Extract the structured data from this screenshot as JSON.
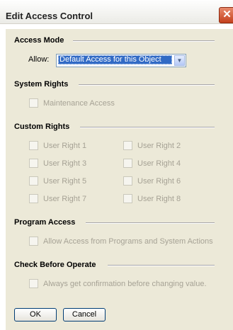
{
  "window": {
    "title": "Edit Access Control",
    "close_symbol": "✕"
  },
  "access_mode": {
    "heading": "Access Mode",
    "allow_label": "Allow:",
    "allow_value": "Default Access for this Object",
    "dropdown_arrow": "▼"
  },
  "system_rights": {
    "heading": "System Rights",
    "items": [
      {
        "label": "Maintenance Access",
        "checked": false
      }
    ]
  },
  "custom_rights": {
    "heading": "Custom Rights",
    "items": [
      {
        "label": "User Right 1",
        "checked": false
      },
      {
        "label": "User Right 2",
        "checked": false
      },
      {
        "label": "User Right 3",
        "checked": false
      },
      {
        "label": "User Right 4",
        "checked": false
      },
      {
        "label": "User Right 5",
        "checked": false
      },
      {
        "label": "User Right 6",
        "checked": false
      },
      {
        "label": "User Right 7",
        "checked": false
      },
      {
        "label": "User Right 8",
        "checked": false
      }
    ]
  },
  "program_access": {
    "heading": "Program Access",
    "items": [
      {
        "label": "Allow Access from Programs and System Actions",
        "checked": false
      }
    ]
  },
  "check_before_operate": {
    "heading": "Check Before Operate",
    "items": [
      {
        "label": "Always get confirmation before changing value.",
        "checked": false
      }
    ]
  },
  "buttons": {
    "ok": "OK",
    "cancel": "Cancel"
  }
}
